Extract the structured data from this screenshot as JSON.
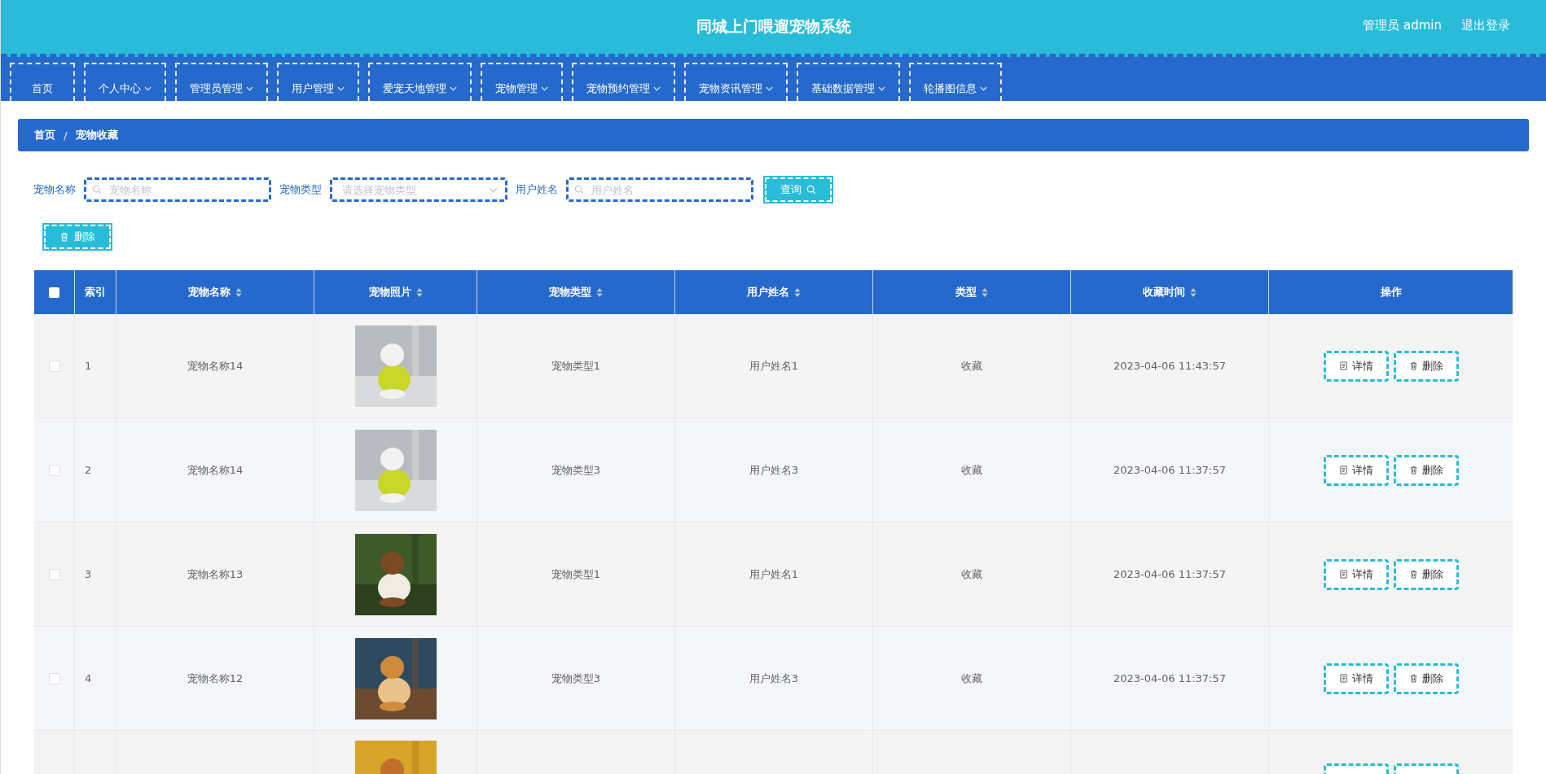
{
  "header": {
    "title": "同城上门喂遛宠物系统",
    "user": "管理员 admin",
    "logout": "退出登录"
  },
  "nav": [
    {
      "label": "首页",
      "dropdown": false
    },
    {
      "label": "个人中心",
      "dropdown": true
    },
    {
      "label": "管理员管理",
      "dropdown": true
    },
    {
      "label": "用户管理",
      "dropdown": true
    },
    {
      "label": "爱宠天地管理",
      "dropdown": true
    },
    {
      "label": "宠物管理",
      "dropdown": true
    },
    {
      "label": "宠物预约管理",
      "dropdown": true
    },
    {
      "label": "宠物资讯管理",
      "dropdown": true
    },
    {
      "label": "基础数据管理",
      "dropdown": true
    },
    {
      "label": "轮播图信息",
      "dropdown": true
    }
  ],
  "breadcrumb": [
    "首页",
    "宠物收藏"
  ],
  "breadcrumb_separator": "/",
  "search": [
    {
      "kind": "input",
      "label": "宠物名称",
      "placeholder": "宠物名称"
    },
    {
      "kind": "select",
      "label": "宠物类型",
      "placeholder": "请选择宠物类型"
    },
    {
      "kind": "input",
      "label": "用户姓名",
      "placeholder": "用户姓名"
    }
  ],
  "query_button": "查询",
  "delete_button": "删除",
  "table": {
    "select_all_checked": false,
    "columns": [
      {
        "label": "索引",
        "sortable": false
      },
      {
        "label": "宠物名称",
        "sortable": true
      },
      {
        "label": "宠物照片",
        "sortable": true
      },
      {
        "label": "宠物类型",
        "sortable": true
      },
      {
        "label": "用户姓名",
        "sortable": true
      },
      {
        "label": "类型",
        "sortable": true
      },
      {
        "label": "收藏时间",
        "sortable": true
      },
      {
        "label": "操作",
        "sortable": false
      }
    ],
    "rows": [
      {
        "kind": "full",
        "checked": false,
        "index": "1",
        "name": "宠物名称14",
        "type": "宠物类型1",
        "user": "用户姓名1",
        "category": "收藏",
        "time": "2023-04-06 11:43:57",
        "actions": [
          "详情",
          "删除"
        ]
      },
      {
        "kind": "full",
        "checked": false,
        "index": "2",
        "name": "宠物名称14",
        "type": "宠物类型3",
        "user": "用户姓名3",
        "category": "收藏",
        "time": "2023-04-06 11:37:57",
        "actions": [
          "详情",
          "删除"
        ]
      },
      {
        "kind": "full",
        "checked": false,
        "index": "3",
        "name": "宠物名称13",
        "type": "宠物类型1",
        "user": "用户姓名1",
        "category": "收藏",
        "time": "2023-04-06 11:37:57",
        "actions": [
          "详情",
          "删除"
        ]
      },
      {
        "kind": "full",
        "checked": false,
        "index": "4",
        "name": "宠物名称12",
        "type": "宠物类型3",
        "user": "用户姓名3",
        "category": "收藏",
        "time": "2023-04-06 11:37:57",
        "actions": [
          "详情",
          "删除"
        ]
      },
      {
        "kind": "partial"
      }
    ]
  }
}
